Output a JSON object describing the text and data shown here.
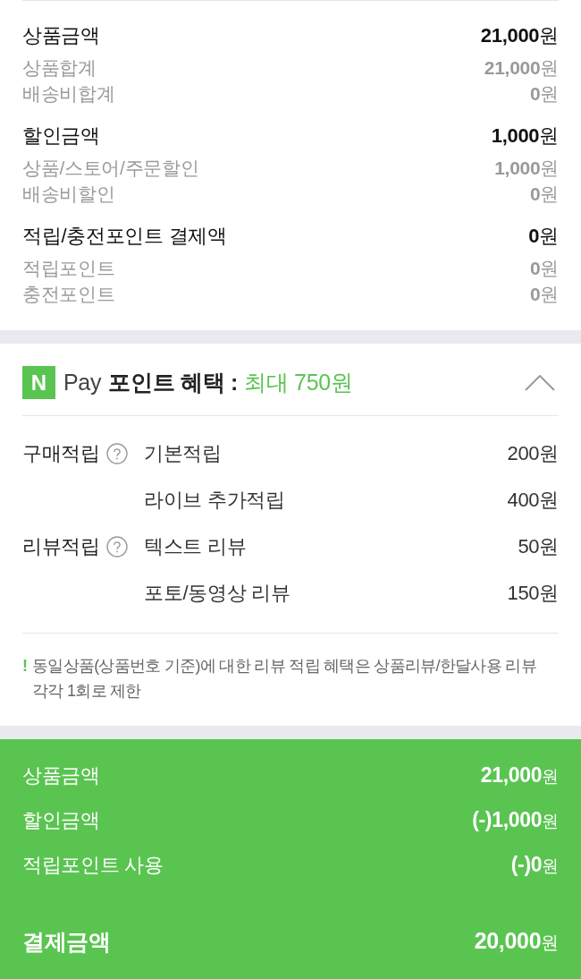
{
  "summary": {
    "groups": [
      {
        "label": "상품금액",
        "amount": "**21,000**원",
        "items": [
          {
            "label": "상품합계",
            "amount": "**21,000**원"
          },
          {
            "label": "배송비합계",
            "amount": "**0**원"
          }
        ]
      },
      {
        "label": "할인금액",
        "amount": "**1,000**원",
        "items": [
          {
            "label": "상품/스토어/주문할인",
            "amount": "**1,000**원"
          },
          {
            "label": "배송비할인",
            "amount": "**0**원"
          }
        ]
      },
      {
        "label": "적립/충전포인트 결제액",
        "amount": "**0**원",
        "items": [
          {
            "label": "적립포인트",
            "amount": "**0**원"
          },
          {
            "label": "충전포인트",
            "amount": "**0**원"
          }
        ]
      }
    ]
  },
  "point_benefit": {
    "logo": "N",
    "brand": "Pay",
    "title": "포인트 혜택 :",
    "highlight": "최대 750원",
    "expanded": true,
    "categories": [
      {
        "label": "구매적립",
        "items": [
          {
            "label": "기본적립",
            "amount": "200원"
          },
          {
            "label": "라이브 추가적립",
            "amount": "400원"
          }
        ]
      },
      {
        "label": "리뷰적립",
        "items": [
          {
            "label": "텍스트 리뷰",
            "amount": "50원"
          },
          {
            "label": "포토/동영상 리뷰",
            "amount": "150원"
          }
        ]
      }
    ],
    "notice": {
      "mark": "!",
      "text": "동일상품(상품번호 기준)에 대한 리뷰 적립 혜택은 상품리뷰/한달사용 리뷰 각각 1회로 제한"
    }
  },
  "payment": {
    "rows": [
      {
        "label": "상품금액",
        "amount": "**21,000**원"
      },
      {
        "label": "할인금액",
        "amount": "**(-)1,000**원"
      },
      {
        "label": "적립포인트 사용",
        "amount": "**(-)0**원"
      }
    ],
    "total": {
      "label": "결제금액",
      "amount": "**20,000**원"
    }
  }
}
